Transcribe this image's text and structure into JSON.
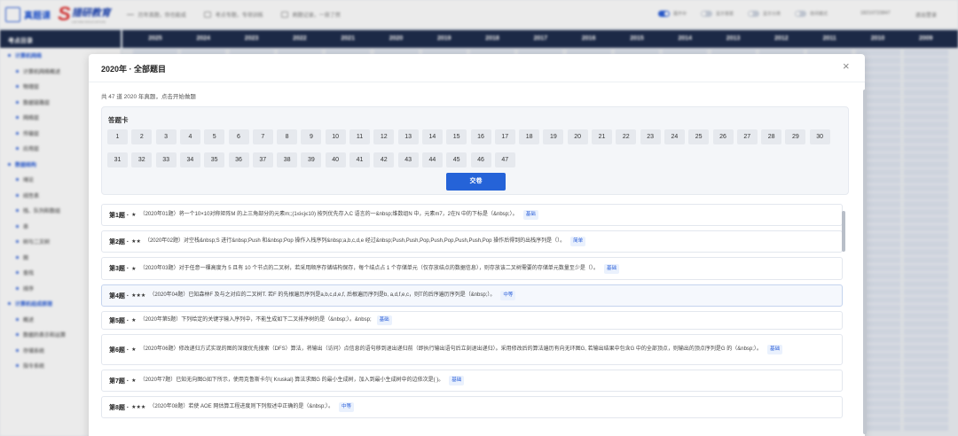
{
  "topbar": {
    "logo_text": "真题课",
    "brand": "猎研教育",
    "brand_sub": "LIEYAN EDUCATION",
    "nav": [
      "历年真题，你也能成",
      "考点专题，专项训练",
      "刷题记录，一目了然"
    ],
    "toggles": [
      {
        "label": "展开中",
        "on": true
      },
      {
        "label": "显示答案",
        "on": false
      },
      {
        "label": "显示分类",
        "on": false
      },
      {
        "label": "夜间模式",
        "on": false
      }
    ],
    "phone": "18210723847",
    "logout": "退出登录"
  },
  "sidebar": {
    "title": "考点目录",
    "items": [
      {
        "label": "计算机网络",
        "level": 1
      },
      {
        "label": "计算机网络概述",
        "level": 2
      },
      {
        "label": "物理层",
        "level": 2
      },
      {
        "label": "数据链路层",
        "level": 2
      },
      {
        "label": "网络层",
        "level": 2
      },
      {
        "label": "传输层",
        "level": 2
      },
      {
        "label": "应用层",
        "level": 2
      },
      {
        "label": "数据结构",
        "level": 1
      },
      {
        "label": "绪论",
        "level": 2
      },
      {
        "label": "线性表",
        "level": 2
      },
      {
        "label": "栈、队列和数组",
        "level": 2
      },
      {
        "label": "串",
        "level": 2
      },
      {
        "label": "树与二叉树",
        "level": 2
      },
      {
        "label": "图",
        "level": 2
      },
      {
        "label": "查找",
        "level": 2
      },
      {
        "label": "排序",
        "level": 2
      },
      {
        "label": "计算机组成原理",
        "level": 1
      },
      {
        "label": "概述",
        "level": 2
      },
      {
        "label": "数据的表示和运算",
        "level": 2
      },
      {
        "label": "存储系统",
        "level": 2
      },
      {
        "label": "指令系统",
        "level": 2
      }
    ]
  },
  "years": [
    "2025",
    "2024",
    "2023",
    "2022",
    "2021",
    "2020",
    "2019",
    "2018",
    "2017",
    "2016",
    "2015",
    "2014",
    "2013",
    "2012",
    "2011",
    "2010",
    "2009"
  ],
  "modal": {
    "title": "2020年 · 全部题目",
    "close": "×",
    "desc": "共 47 道 2020 年真题，点击开始做题",
    "card_title": "答题卡",
    "numbers": [
      1,
      2,
      3,
      4,
      5,
      6,
      7,
      8,
      9,
      10,
      11,
      12,
      13,
      14,
      15,
      16,
      17,
      18,
      19,
      20,
      21,
      22,
      23,
      24,
      25,
      26,
      27,
      28,
      29,
      30,
      31,
      32,
      33,
      34,
      35,
      36,
      37,
      38,
      39,
      40,
      41,
      42,
      43,
      44,
      45,
      46,
      47
    ],
    "submit": "交卷",
    "questions": [
      {
        "no": "第1题 ·",
        "stars": "★",
        "text": "（2020年01题）将一个10×10对称矩阵M 的上三角部分的元素m;;(1≤i≤j≤10) 按列优先存入C 语言的一&nbsp;维数组N 中，元素m7，2在N 中的下标是（&nbsp;）。",
        "badge": "基础"
      },
      {
        "no": "第2题 ·",
        "stars": "★★",
        "text": "（2020年02题）对空栈&nbsp;S 进行&nbsp;Push 和&nbsp;Pop 操作入栈序列&nbsp;a,b,c,d,e 经过&nbsp;Push,Push,Pop,Push,Pop,Push,Push,Pop 操作后得到的出栈序列是（）。",
        "badge": "简单"
      },
      {
        "no": "第3题 ·",
        "stars": "★",
        "text": "（2020年03题）对于任意一棵高度为 5 且有 10 个节点的二叉树，若采用顺序存储结构保存，每个结点占 1 个存储单元（仅存放结点的数据信息），则存放该二叉树需要的存储单元数量至少是（）。",
        "badge": "基础"
      },
      {
        "no": "第4题 ·",
        "stars": "★★★",
        "text": "（2020年04题）已知森林F 及与之对应的二叉树T. 若F 的先根遍历序列是a,b,c,d,e,f, 后根遍历序列是b, a,d,f,e,c，则T的后序遍历序列是（&nbsp;）。",
        "badge": "中等"
      },
      {
        "no": "第5题 ·",
        "stars": "★",
        "text": "（2020年第5题）下列给定的关键字输入序列中，不能生成如下二叉排序树的是（&nbsp;）。&nbsp;",
        "badge": "基础"
      },
      {
        "no": "第6题 ·",
        "stars": "★",
        "text": "（2020年06题）修改递归方式实现的图的深度优先搜索（DFS）算法，将输出（访问）点信息的语句移到退出递归前（即执行输出语句后立刻退出递归）。采用修改后的算法遍历有向无环图G, 若输出结果中包含G 中的全部顶点，则输出的顶点序列是G 的（&nbsp;）。",
        "badge": "基础"
      },
      {
        "no": "第7题 ·",
        "stars": "★",
        "text": "（2020年7题）已知无向图G如下所示，使用克鲁斯卡尔( Kruskal) 算法求图G 的最小生成树，加入到最小生成树中的边依次是( )。",
        "badge": "基础"
      },
      {
        "no": "第8题 ·",
        "stars": "★★★",
        "text": "（2020年08题）若使 AOE 网估算工程进度则下列叙述中正确的是（&nbsp;）。",
        "badge": "中等"
      }
    ]
  }
}
